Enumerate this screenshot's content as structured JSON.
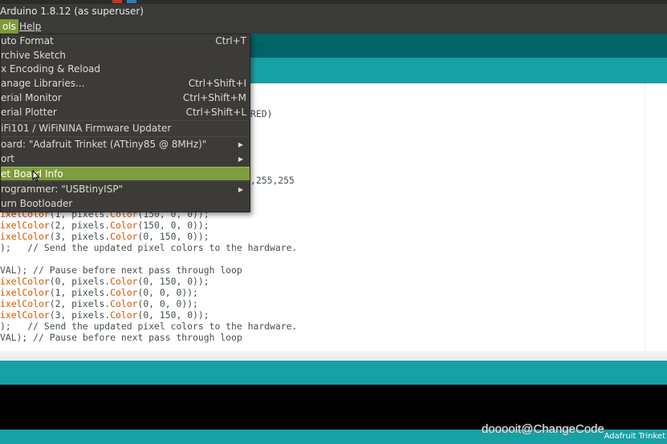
{
  "window": {
    "title": "Arduino 1.8.12 (as superuser)"
  },
  "menubar": {
    "items": [
      {
        "label": "ols"
      },
      {
        "label": "Help"
      }
    ]
  },
  "tools_menu": {
    "items": [
      {
        "label": "uto Format",
        "shortcut": "Ctrl+T"
      },
      {
        "label": "rchive Sketch",
        "shortcut": ""
      },
      {
        "label": "x Encoding & Reload",
        "shortcut": ""
      },
      {
        "label": "anage Libraries...",
        "shortcut": "Ctrl+Shift+I"
      },
      {
        "label": "erial Monitor",
        "shortcut": "Ctrl+Shift+M"
      },
      {
        "label": "erial Plotter",
        "shortcut": "Ctrl+Shift+L"
      },
      {
        "label": "iFi101 / WiFiNINA Firmware Updater",
        "shortcut": ""
      },
      {
        "label": "oard: \"Adafruit Trinket (ATtiny85 @ 8MHz)\"",
        "shortcut": ""
      },
      {
        "label": "ort",
        "shortcut": ""
      },
      {
        "label": "et Board Info",
        "shortcut": ""
      },
      {
        "label": "rogrammer: \"USBtinyISP\"",
        "shortcut": ""
      },
      {
        "label": "urn Bootloader",
        "shortcut": ""
      }
    ]
  },
  "editor": {
    "partial_lines": [
      {
        "text": "RED)"
      },
      {
        "text": ",255,255"
      }
    ],
    "lines": [
      {
        "fn": "ixelColor",
        "rest": "(1, pixels.",
        "fn2": "Color",
        "rest2": "(150, 0, 0));"
      },
      {
        "fn": "ixelColor",
        "rest": "(2, pixels.",
        "fn2": "Color",
        "rest2": "(150, 0, 0));"
      },
      {
        "fn": "ixelColor",
        "rest": "(3, pixels.",
        "fn2": "Color",
        "rest2": "(0, 150, 0));"
      },
      {
        "fn": "",
        "rest": ");   // Send the updated pixel colors to the hardware.",
        "fn2": "",
        "rest2": ""
      },
      {
        "fn": "",
        "rest": "",
        "fn2": "",
        "rest2": ""
      },
      {
        "fn": "",
        "rest": "VAL); // Pause before next pass through loop",
        "fn2": "",
        "rest2": ""
      },
      {
        "fn": "ixelColor",
        "rest": "(0, pixels.",
        "fn2": "Color",
        "rest2": "(0, 150, 0));"
      },
      {
        "fn": "ixelColor",
        "rest": "(1, pixels.",
        "fn2": "Color",
        "rest2": "(0, 0, 0));"
      },
      {
        "fn": "ixelColor",
        "rest": "(2, pixels.",
        "fn2": "Color",
        "rest2": "(0, 0, 0));"
      },
      {
        "fn": "ixelColor",
        "rest": "(3, pixels.",
        "fn2": "Color",
        "rest2": "(0, 150, 0));"
      },
      {
        "fn": "",
        "rest": ");   // Send the updated pixel colors to the hardware.",
        "fn2": "",
        "rest2": ""
      },
      {
        "fn": "",
        "rest": "VAL); // Pause before next pass through loop",
        "fn2": "",
        "rest2": ""
      }
    ]
  },
  "footer": {
    "board": "Adafruit Trinket"
  },
  "watermark": "dooooit@ChangeCode",
  "colors": {
    "menu_bg": "#3c3b37",
    "highlight": "#7f9c3e",
    "teal": "#17a1a5",
    "toolbar": "#006468",
    "keyword": "#d35400"
  },
  "icons": {
    "submenu": "triangle-right-icon",
    "pointer": "mouse-pointer-icon"
  }
}
